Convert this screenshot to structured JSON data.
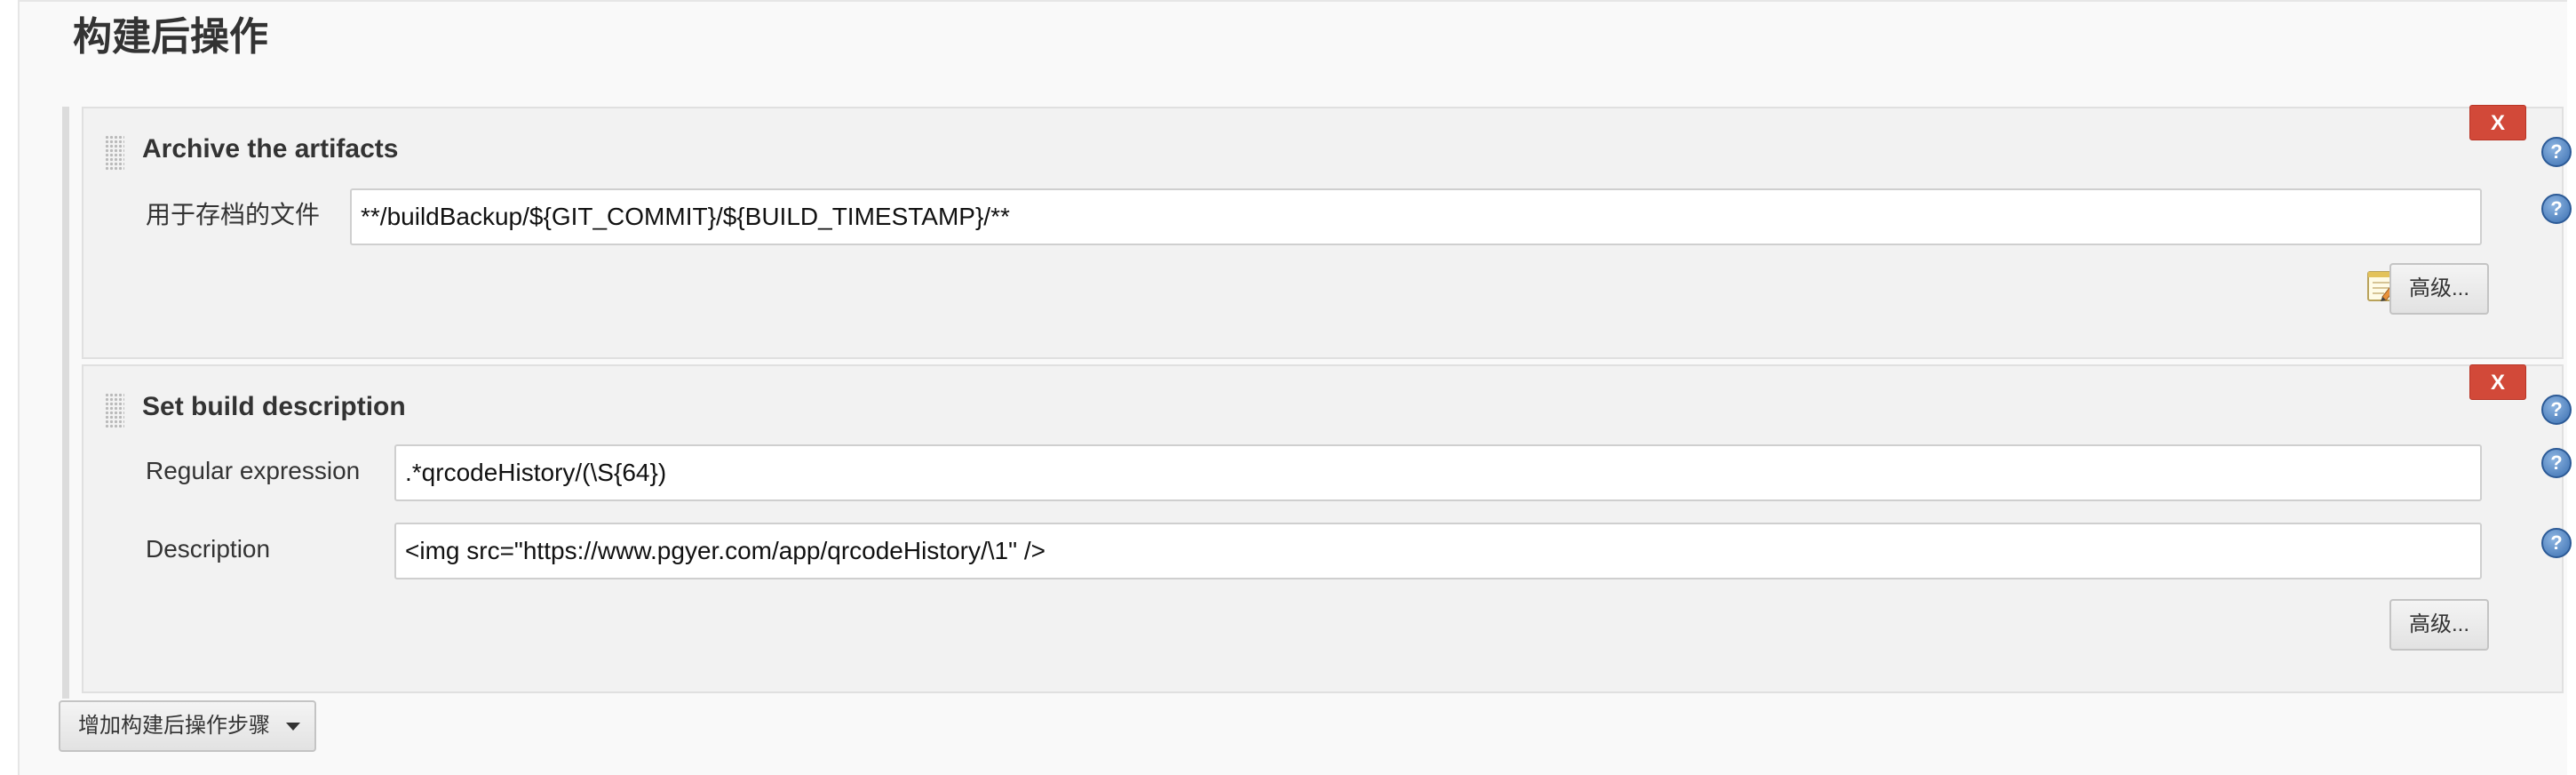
{
  "section": {
    "title": "构建后操作"
  },
  "steps": [
    {
      "title": "Archive the artifacts",
      "delete_label": "X",
      "help_icon": "question-mark-icon",
      "fields": [
        {
          "label": "用于存档的文件",
          "value": "**/buildBackup/${GIT_COMMIT}/${BUILD_TIMESTAMP}/**"
        }
      ],
      "edit_icon": "notepad-pencil-icon",
      "advanced_label": "高级..."
    },
    {
      "title": "Set build description",
      "delete_label": "X",
      "help_icon": "question-mark-icon",
      "fields": [
        {
          "label": "Regular expression",
          "value": ".*qrcodeHistory/(\\S{64})"
        },
        {
          "label": "Description",
          "value": "<img src=\"https://www.pgyer.com/app/qrcodeHistory/\\1\" />"
        }
      ],
      "advanced_label": "高级..."
    }
  ],
  "add_step": {
    "label": "增加构建后操作步骤"
  },
  "colors": {
    "delete_button": "#d24939",
    "help_icon": "#3a6fb1",
    "panel_bg": "#f2f2f2"
  }
}
